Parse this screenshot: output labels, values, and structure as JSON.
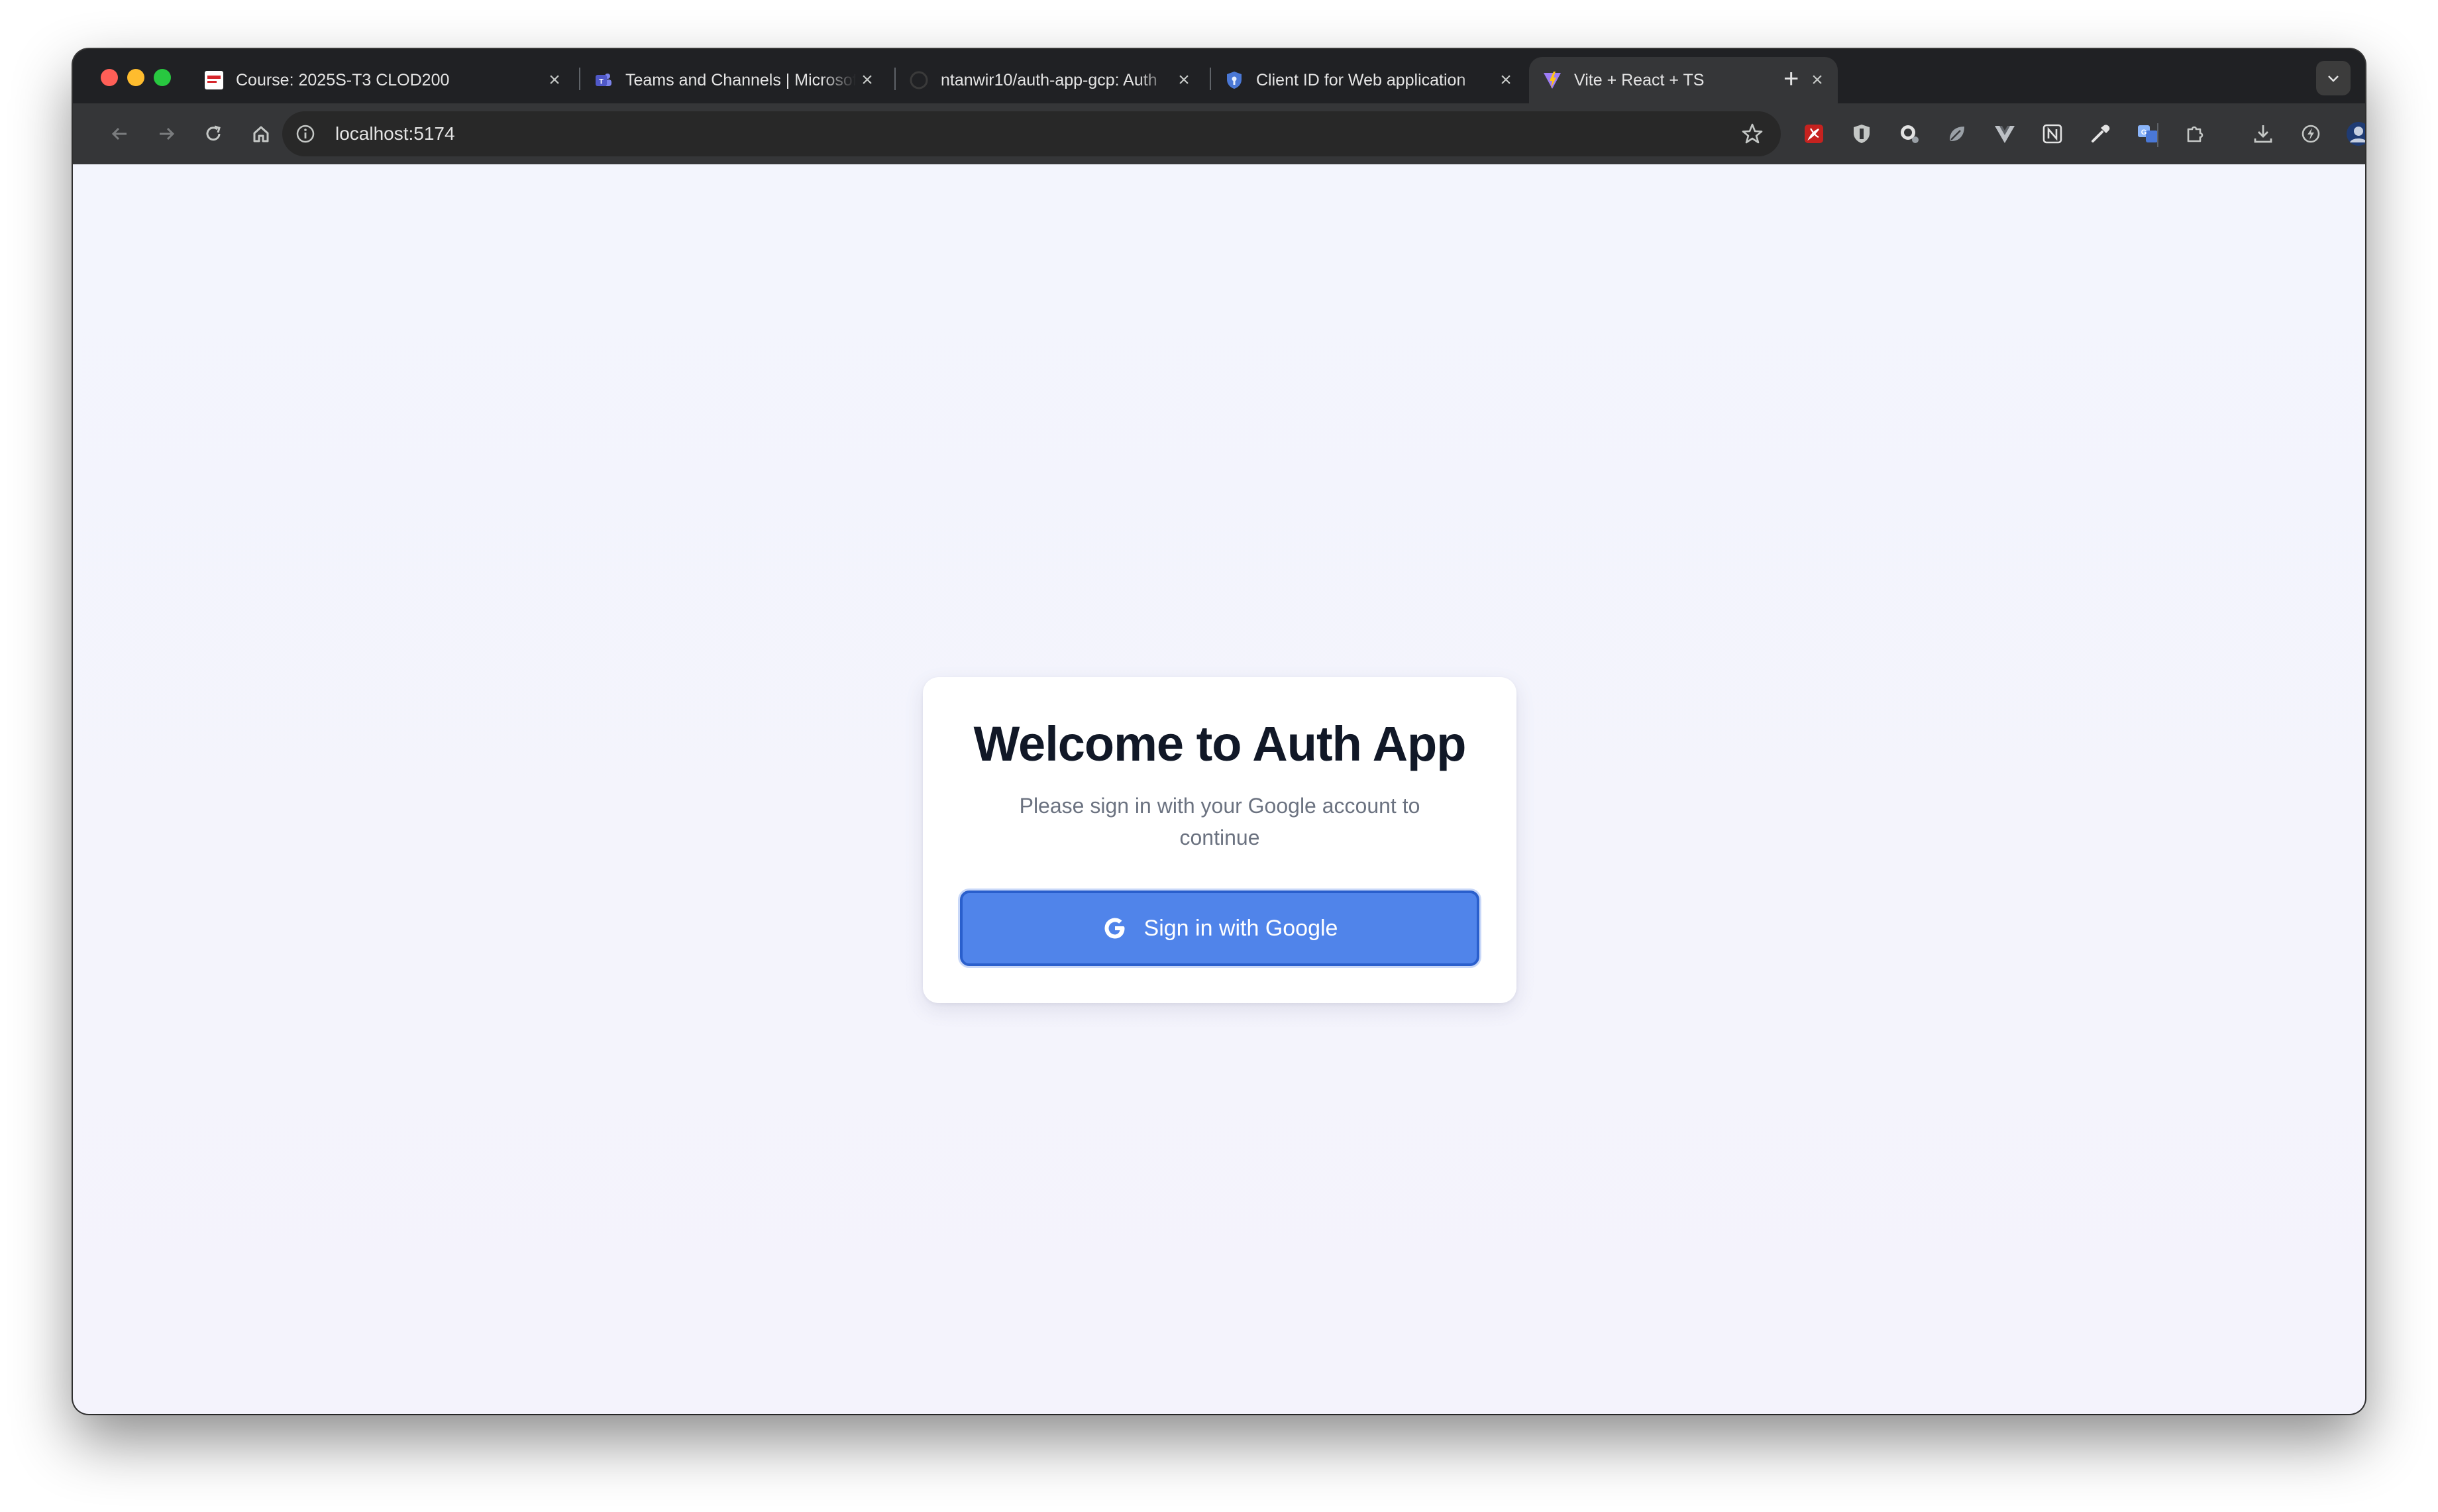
{
  "browser": {
    "tabs": [
      {
        "title": "Course: 2025S-T3 CLOD200",
        "favicon": "course-favicon"
      },
      {
        "title": "Teams and Channels | Microsoft",
        "favicon": "teams-favicon"
      },
      {
        "title": "ntanwir10/auth-app-gcp: Auth",
        "favicon": "github-favicon"
      },
      {
        "title": "Client ID for Web application",
        "favicon": "google-cloud-shield-favicon"
      },
      {
        "title": "Vite + React + TS",
        "favicon": "vite-favicon",
        "active": true
      }
    ],
    "close_glyph": "×",
    "new_tab_glyph": "+",
    "url": "localhost:5174"
  },
  "page": {
    "title": "Welcome to Auth App",
    "subtitle": "Please sign in with your Google account to continue",
    "signin_label": "Sign in with Google",
    "signin_color": "#5084ea"
  }
}
